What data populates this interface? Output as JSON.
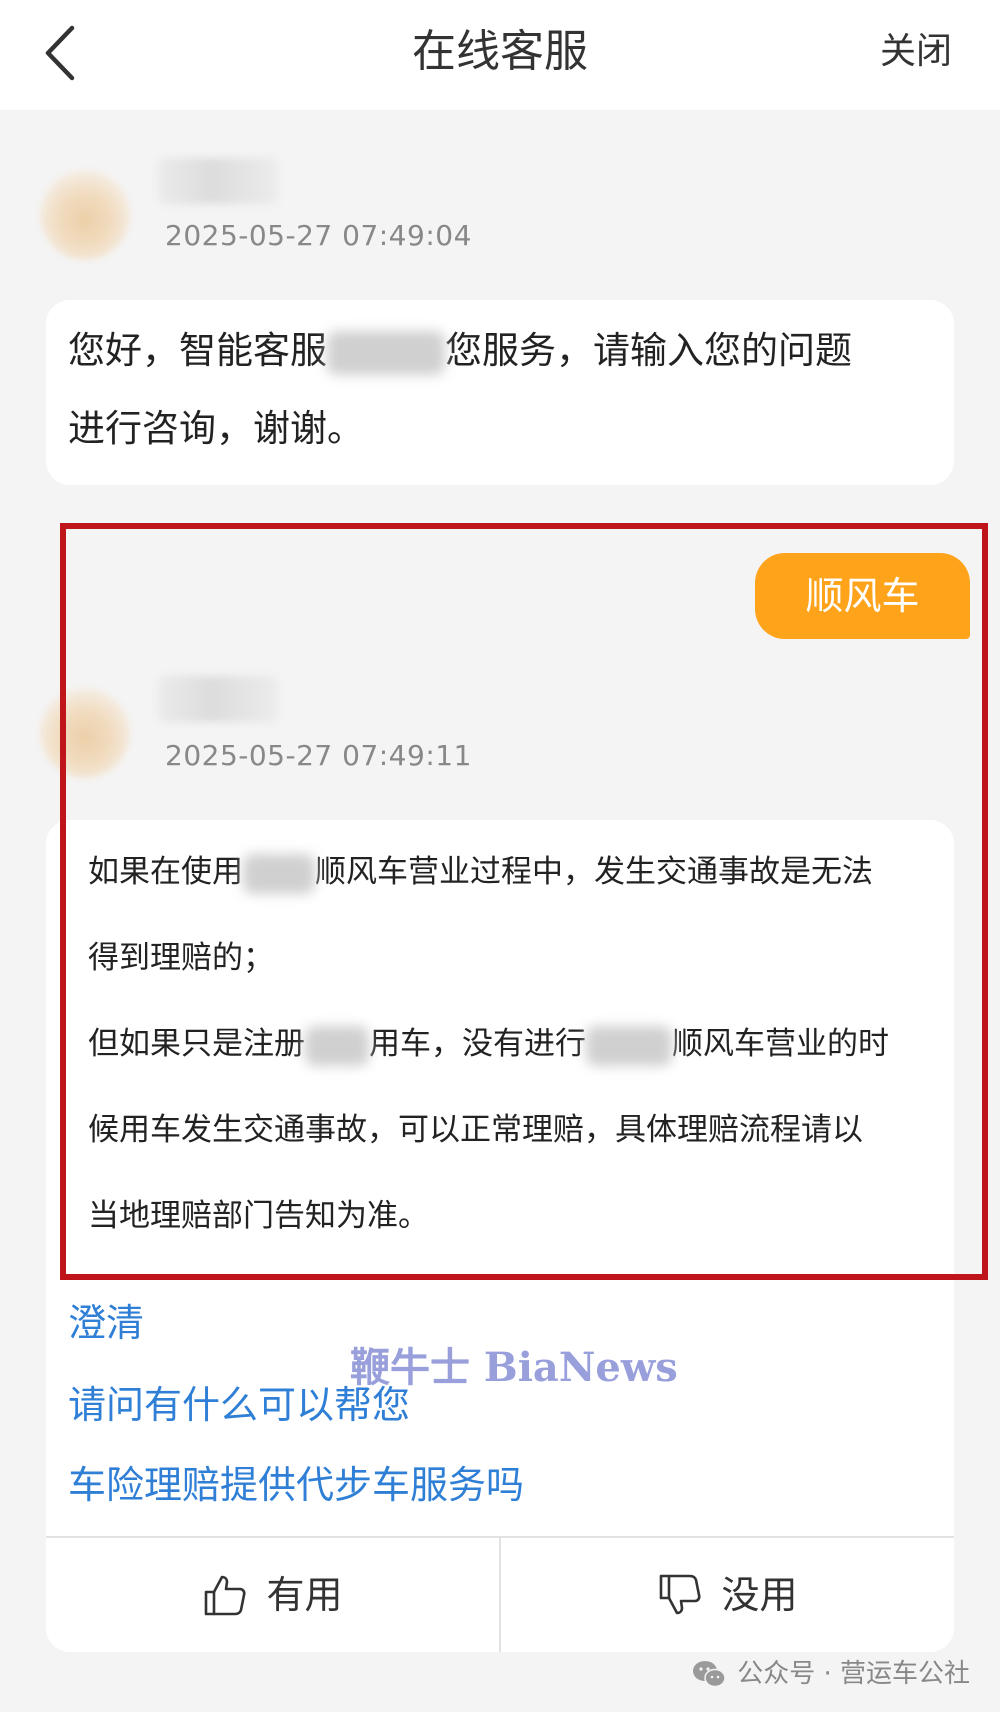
{
  "header": {
    "title": "在线客服",
    "close_label": "关闭"
  },
  "messages": {
    "first": {
      "timestamp": "2025-05-27 07:49:04",
      "text_part1": "您好，智能客服",
      "text_part2": "您服务，请输入您的问题",
      "text_line2": "进行咨询，谢谢。"
    },
    "user_query": "顺风车",
    "second": {
      "timestamp": "2025-05-27 07:49:11",
      "line1_a": "如果在使用",
      "line1_b": "顺风车营业过程中，发生交通事故是无法",
      "line2": "得到理赔的；",
      "line3_a": "但如果只是注册",
      "line3_b": "用车，没有进行",
      "line3_c": "顺风车营业的时",
      "line4": "候用车发生交通事故，可以正常理赔，具体理赔流程请以",
      "line5": "当地理赔部门告知为准。"
    }
  },
  "suggestions": [
    "澄清",
    "请问有什么可以帮您",
    "车险理赔提供代步车服务吗"
  ],
  "feedback": {
    "useful_label": "有用",
    "useless_label": "没用"
  },
  "watermark": "鞭牛士 BiaNews",
  "attribution": "公众号 · 营运车公社",
  "colors": {
    "accent_orange": "#ffa31a",
    "link_blue": "#2f7fd6",
    "frame_red": "#c0141b"
  }
}
